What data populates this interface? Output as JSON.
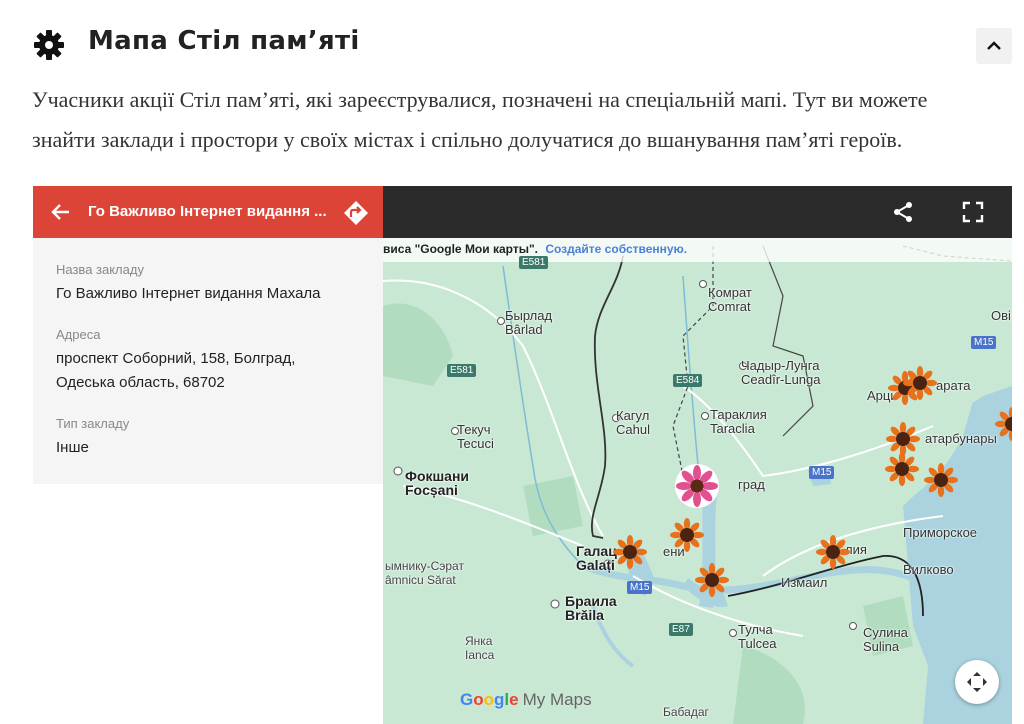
{
  "section": {
    "title": "Мапа Стіл пам’яті",
    "intro": "Учасники акції Стіл пам’яті, які зареєструвалися, позначені на спеціальній мапі. Тут ви можете знайти заклади і простори у своїх містах і спільно долучатися до вшанування пам’яті героїв.",
    "header_icon": "gear-icon",
    "collapse_icon": "chevron-up-icon"
  },
  "sidebar": {
    "header_title": "Го Важливо Інтернет видання ...",
    "fields": [
      {
        "label": "Назва закладу",
        "value": "Го Важливо Інтернет видання Махала"
      },
      {
        "label": "Адреса",
        "value": "проспект Соборний, 158, Болград,",
        "value2": "Одеська область, 68702"
      },
      {
        "label": "Тип закладу",
        "value": "Інше"
      }
    ]
  },
  "map": {
    "attribution": "виса \"Google Мои карты\".",
    "attribution_link": "Создайте собственную.",
    "logo": {
      "g": "G",
      "o1": "o",
      "o2": "o",
      "g2": "g",
      "l": "l",
      "e": "e",
      "mymaps": "My Maps"
    },
    "labels": {
      "komrat_cyr": "Комрат",
      "komrat_lat": "Comrat",
      "birlad_cyr": "Бырлад",
      "birlad_lat": "Bârlad",
      "ceadir_cyr": "Чадыр-Лунга",
      "ceadir_lat": "Ceadîr-Lunga",
      "cahul_cyr": "Кагул",
      "cahul_lat": "Cahul",
      "taraclia_cyr": "Тараклия",
      "taraclia_lat": "Taraclia",
      "tecuci_cyr": "Текуч",
      "tecuci_lat": "Tecuci",
      "focsani_cyr": "Фокшани",
      "focsani_lat": "Focșani",
      "bolgrad": "град",
      "galati_cyr": "Галац",
      "galati_lat": "Galați",
      "galati_suffix": "ени",
      "rimnicu_cyr": "ымнику-Сэрат",
      "rimnicu_lat": "âmnicu Sărat",
      "izmail": "Измаил",
      "braila_cyr": "Браила",
      "braila_lat": "Brăila",
      "tulcea_cyr": "Тулча",
      "tulcea_lat": "Tulcea",
      "ianca_cyr": "Янка",
      "ianca_lat": "Ianca",
      "sulina_cyr": "Сулина",
      "sulina_lat": "Sulina",
      "vilkovo": "Вилково",
      "primorskoe": "Приморское",
      "tatarbunary": "атарбунары",
      "artsyz": "Арци",
      "sarata": "арата",
      "kiliya": "лия",
      "ovi": "Ові",
      "babadag": "Бабадаг"
    },
    "roads": {
      "e581a": "E581",
      "e581b": "E581",
      "e584": "E584",
      "m15a": "M15",
      "m15b": "M15",
      "m15c": "M15",
      "e87": "E87"
    },
    "colors": {
      "water": "#aad3df",
      "land": "#c9e8d4",
      "park": "#b2dcbf",
      "pin": "#e8711c",
      "selected_pin": "#e2508f",
      "header_red": "#db4437"
    }
  }
}
